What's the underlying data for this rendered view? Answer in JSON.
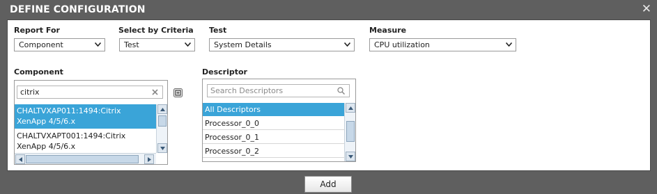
{
  "dialog": {
    "title": "DEFINE CONFIGURATION",
    "close_glyph": "✕"
  },
  "fields": {
    "report_for": {
      "label": "Report For",
      "value": "Component"
    },
    "criteria": {
      "label": "Select by Criteria",
      "value": "Test"
    },
    "test": {
      "label": "Test",
      "value": "System Details"
    },
    "measure": {
      "label": "Measure",
      "value": "CPU utilization"
    }
  },
  "component": {
    "label": "Component",
    "search_value": "citrix",
    "items": [
      {
        "line1": "CHALTVXAP011:1494:Citrix",
        "line2": "XenApp 4/5/6.x",
        "selected": true
      },
      {
        "line1": "CHALTVXAPT001:1494:Citrix",
        "line2": "XenApp 4/5/6.x",
        "selected": false
      }
    ]
  },
  "descriptor": {
    "label": "Descriptor",
    "search_placeholder": "Search Descriptors",
    "items": [
      {
        "label": "All Descriptors",
        "selected": true
      },
      {
        "label": "Processor_0_0",
        "selected": false
      },
      {
        "label": "Processor_0_1",
        "selected": false
      },
      {
        "label": "Processor_0_2",
        "selected": false
      }
    ]
  },
  "actions": {
    "add_label": "Add"
  },
  "colors": {
    "titlebar_bg": "#5f5f5f",
    "selection": "#3aa4d8"
  }
}
